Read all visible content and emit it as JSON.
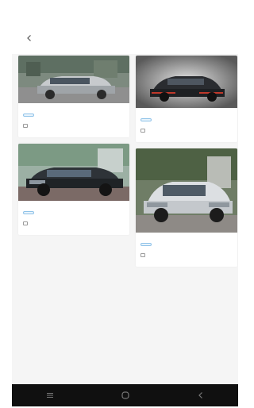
{
  "status_bar": {
    "left_text": "",
    "right_text": ""
  },
  "header": {
    "title": "",
    "back_icon": "back-arrow-icon"
  },
  "cards": {
    "c1": {
      "name": "",
      "tag": "",
      "spec": "",
      "price": ""
    },
    "c2": {
      "name": "",
      "tag": "",
      "spec": "",
      "price": ""
    },
    "c3": {
      "name": "",
      "tag": "",
      "spec": "",
      "price": ""
    },
    "c4": {
      "name": "",
      "tag": "",
      "spec": "",
      "price": ""
    }
  },
  "nav_bar": {
    "items": [
      "menu-icon",
      "home-icon",
      "back-icon"
    ]
  },
  "colors": {
    "tag_text": "#58a3d6",
    "tag_border": "#8ec2e8",
    "price": "#f0b43c",
    "nav_bar": "#101010"
  }
}
